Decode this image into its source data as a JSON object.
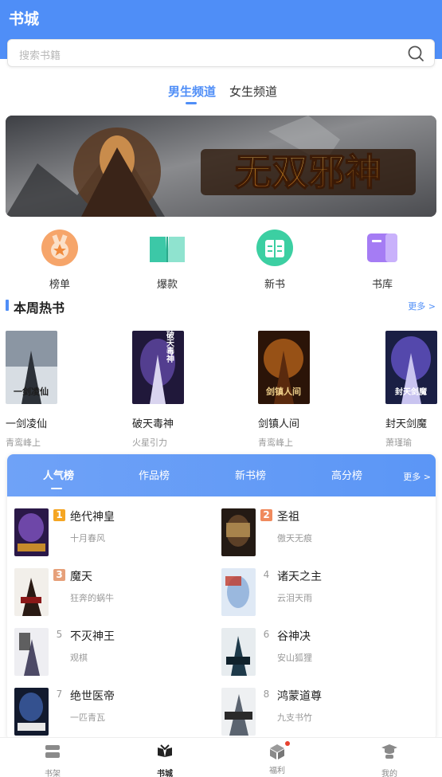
{
  "header": {
    "title": "书城"
  },
  "search": {
    "placeholder": "搜索书籍",
    "icon": "search-icon"
  },
  "channels": {
    "male": "男生频道",
    "female": "女生频道",
    "active": "male"
  },
  "banner": {
    "title_art": "无双邪神"
  },
  "quick": [
    {
      "label": "榜单",
      "icon": "medal-icon",
      "color": "#f29a5c"
    },
    {
      "label": "爆款",
      "icon": "open-book-icon",
      "color": "#34c3a6"
    },
    {
      "label": "新书",
      "icon": "new-book-icon",
      "color": "#3dcba0"
    },
    {
      "label": "书库",
      "icon": "library-icon",
      "color": "#a37af3"
    }
  ],
  "hot_section": {
    "title": "本周热书",
    "more": "更多 >"
  },
  "hot_books": [
    {
      "title": "一剑凌仙",
      "author": "青鸾峰上",
      "cover_text": "一剑凌仙"
    },
    {
      "title": "破天毒神",
      "author": "火星引力",
      "cover_text": "破天毒神"
    },
    {
      "title": "剑镇人间",
      "author": "青鸾峰上",
      "cover_text": "剑镇人间"
    },
    {
      "title": "封天剑魔",
      "author": "萧瑾瑜",
      "cover_text": "封天剑魔"
    }
  ],
  "ranking": {
    "tabs": [
      "人气榜",
      "作品榜",
      "新书榜",
      "高分榜"
    ],
    "active_tab": 0,
    "more": "更多 >",
    "items": [
      {
        "rank": "1",
        "title": "绝代神皇",
        "author": "十月春风"
      },
      {
        "rank": "2",
        "title": "圣祖",
        "author": "傲天无痕"
      },
      {
        "rank": "3",
        "title": "魔天",
        "author": "狂奔的蜗牛"
      },
      {
        "rank": "4",
        "title": "诸天之主",
        "author": "云泪天雨"
      },
      {
        "rank": "5",
        "title": "不灭神王",
        "author": "观棋"
      },
      {
        "rank": "6",
        "title": "谷神决",
        "author": "安山狐狸"
      },
      {
        "rank": "7",
        "title": "绝世医帝",
        "author": "一匹青瓦"
      },
      {
        "rank": "8",
        "title": "鸿蒙道尊",
        "author": "九支书竹"
      }
    ],
    "rank_colors": [
      "#f5a623",
      "#f08a5d",
      "#e6a07a"
    ]
  },
  "bottom_nav": [
    {
      "label": "书架",
      "icon": "bookshelf-icon"
    },
    {
      "label": "书城",
      "icon": "bookstore-icon",
      "active": true
    },
    {
      "label": "福利",
      "icon": "gift-box-icon",
      "badge": true
    },
    {
      "label": "我的",
      "icon": "profile-icon"
    }
  ],
  "colors": {
    "brand": "#4f8ef7",
    "text": "#222222",
    "muted": "#999999"
  }
}
